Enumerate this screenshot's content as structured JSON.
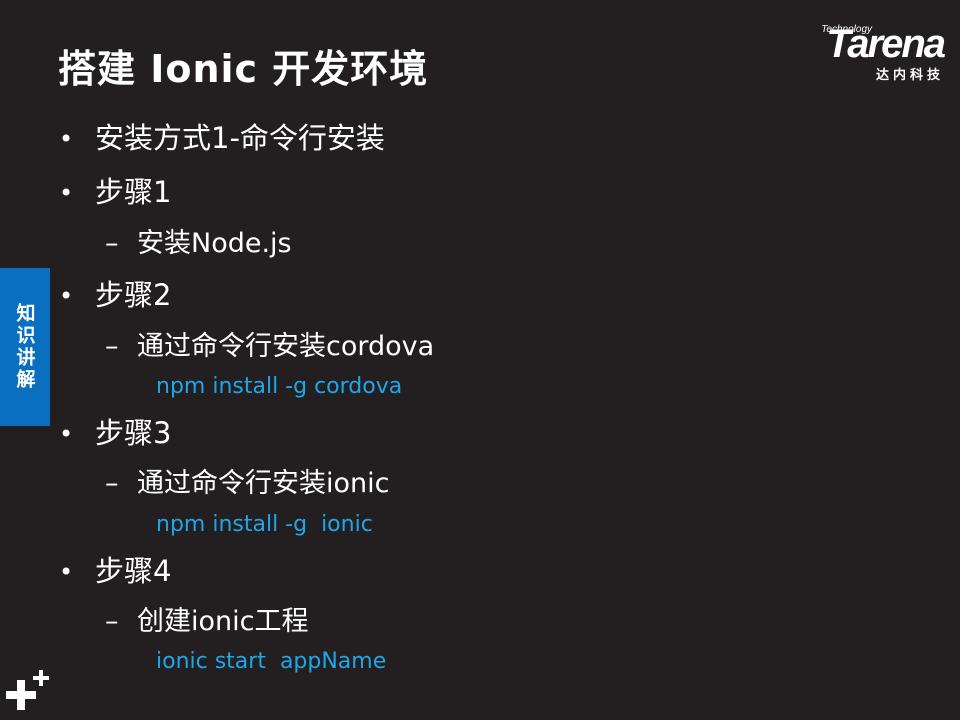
{
  "slide": {
    "title": "搭建 Ionic 开发环境",
    "logo": {
      "technology": "Technology",
      "word": "Tarena",
      "chinese": "达内科技"
    },
    "side_tab": "知识讲解",
    "bullet_glyph": "•",
    "dash_glyph": "–",
    "items": [
      {
        "kind": "l1",
        "text": "安装方式1-命令行安装"
      },
      {
        "kind": "l1",
        "text": "步骤1"
      },
      {
        "kind": "l2",
        "text": "安装Node.js"
      },
      {
        "kind": "l1",
        "text": "步骤2"
      },
      {
        "kind": "l2",
        "text": "通过命令行安装cordova"
      },
      {
        "kind": "code",
        "text": "npm install -g cordova"
      },
      {
        "kind": "l1",
        "text": "步骤3"
      },
      {
        "kind": "l2",
        "text": "通过命令行安装ionic"
      },
      {
        "kind": "code",
        "text": "npm install -g  ionic"
      },
      {
        "kind": "l1",
        "text": "步骤4"
      },
      {
        "kind": "l2",
        "text": "创建ionic工程"
      },
      {
        "kind": "code",
        "text": "ionic start  appName"
      }
    ]
  }
}
